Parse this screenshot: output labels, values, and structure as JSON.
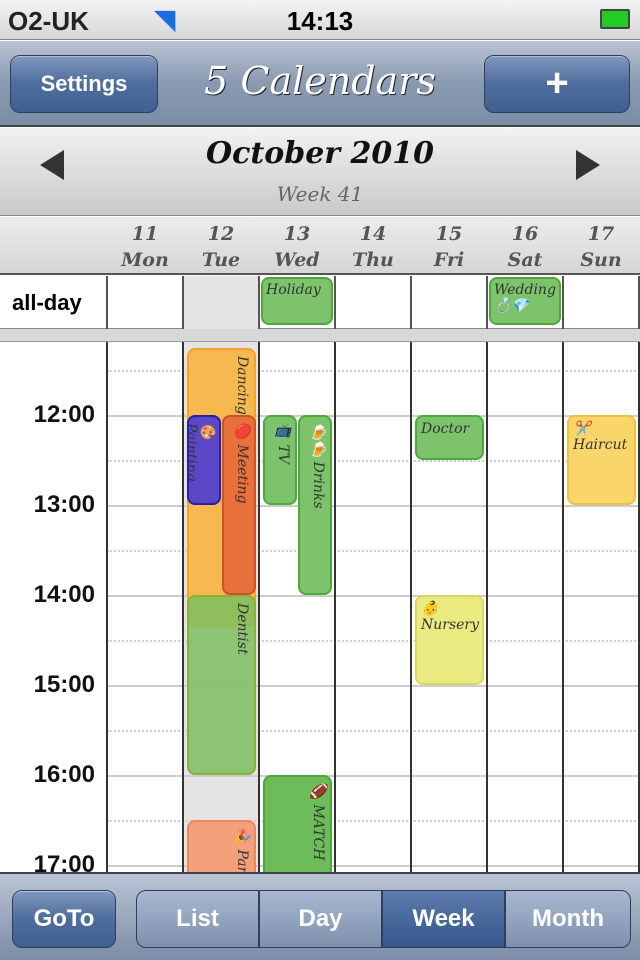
{
  "status": {
    "carrier": "O2-UK",
    "time": "14:13"
  },
  "navbar": {
    "settings": "Settings",
    "title": "5 Calendars",
    "add": "+"
  },
  "month": {
    "title": "October 2010",
    "week": "Week 41"
  },
  "days": [
    {
      "num": "11",
      "name": "Mon"
    },
    {
      "num": "12",
      "name": "Tue"
    },
    {
      "num": "13",
      "name": "Wed"
    },
    {
      "num": "14",
      "name": "Thu"
    },
    {
      "num": "15",
      "name": "Fri"
    },
    {
      "num": "16",
      "name": "Sat"
    },
    {
      "num": "17",
      "name": "Sun"
    }
  ],
  "allday": {
    "label": "all-day",
    "events": [
      {
        "title": "Holiday",
        "day": 2,
        "color": "#7dc36b"
      },
      {
        "title": "Wedding 💍💎",
        "day": 5,
        "color": "#7dc36b"
      }
    ]
  },
  "hours": [
    "12:00",
    "13:00",
    "14:00",
    "15:00",
    "16:00",
    "17:00"
  ],
  "today_index": 1,
  "events": [
    {
      "title": "Dancing",
      "day": 1,
      "start": 11.25,
      "end": 14.35,
      "color": "#f5b94f",
      "border": "#f3a22b",
      "sub": 0,
      "subs": 1,
      "vertical": true
    },
    {
      "title": "🎨 Painting",
      "day": 1,
      "start": 12,
      "end": 13,
      "color": "#5a48c8",
      "border": "#2a1fa8",
      "sub": 0,
      "subs": 2,
      "vertical": true
    },
    {
      "title": "🔴 Meeting",
      "day": 1,
      "start": 12,
      "end": 14,
      "color": "#e8703a",
      "border": "#d0502a",
      "sub": 1,
      "subs": 2,
      "vertical": true
    },
    {
      "title": "Dentist",
      "day": 1,
      "start": 14,
      "end": 16,
      "color": "rgba(125,190,95,0.85)",
      "border": "#8bb03a",
      "sub": 0,
      "subs": 1,
      "vertical": true
    },
    {
      "title": "🎉 Party",
      "day": 1,
      "start": 16.5,
      "end": 17.5,
      "color": "#f4a07a",
      "border": "#e88860",
      "sub": 0,
      "subs": 1,
      "vertical": true
    },
    {
      "title": "📺 TV",
      "day": 2,
      "start": 12,
      "end": 13,
      "color": "#7dc36b",
      "border": "#4ea83a",
      "sub": 0,
      "subs": 2,
      "vertical": true
    },
    {
      "title": "🍺🍺 Drinks",
      "day": 2,
      "start": 12,
      "end": 14,
      "color": "#7dc36b",
      "border": "#4ea83a",
      "sub": 1,
      "subs": 2,
      "vertical": true
    },
    {
      "title": "🏈 MATCH",
      "day": 2,
      "start": 16,
      "end": 17.5,
      "color": "#6cbd5a",
      "border": "#4ea83a",
      "sub": 0,
      "subs": 1,
      "vertical": true
    },
    {
      "title": "Doctor",
      "day": 4,
      "start": 12,
      "end": 12.5,
      "color": "#7dc36b",
      "border": "#4ea83a",
      "sub": 0,
      "subs": 1,
      "vertical": false
    },
    {
      "title": "👶 Nursery",
      "day": 4,
      "start": 14,
      "end": 15,
      "color": "#e9ea7f",
      "border": "#d8d860",
      "sub": 0,
      "subs": 1,
      "vertical": false
    },
    {
      "title": "✂️ Haircut",
      "day": 6,
      "start": 12,
      "end": 13,
      "color": "#fad66a",
      "border": "#f0c040",
      "sub": 0,
      "subs": 1,
      "vertical": false
    }
  ],
  "bottom": {
    "goto": "GoTo",
    "segments": [
      "List",
      "Day",
      "Week",
      "Month"
    ],
    "selected": "Week"
  }
}
